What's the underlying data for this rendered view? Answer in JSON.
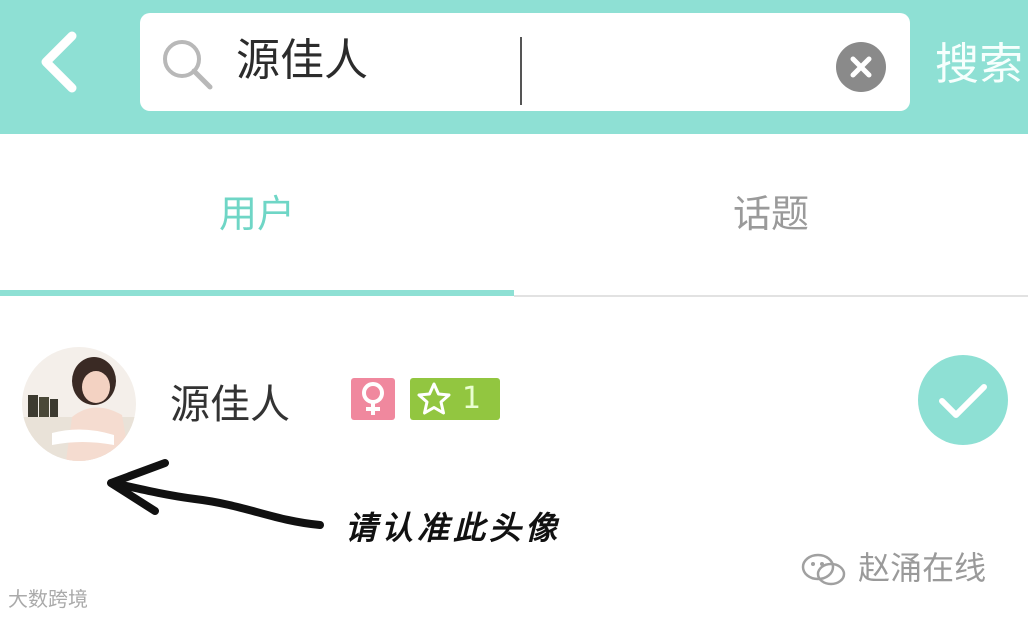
{
  "search": {
    "query": "源佳人",
    "submit_label": "搜索"
  },
  "tabs": [
    {
      "label": "用户",
      "active": true
    },
    {
      "label": "话题",
      "active": false
    }
  ],
  "result": {
    "name": "源佳人",
    "gender_icon": "female-icon",
    "level": "1",
    "level_icon": "star-icon",
    "follow_state": "check-icon"
  },
  "annotation": {
    "text": "请认准此头像"
  },
  "watermarks": {
    "right": "赵涌在线",
    "left": "大数跨境"
  },
  "colors": {
    "accent": "#8ee0d4",
    "tab_active": "#6fd6c6",
    "female_badge": "#f0889e",
    "level_badge": "#92c640"
  }
}
